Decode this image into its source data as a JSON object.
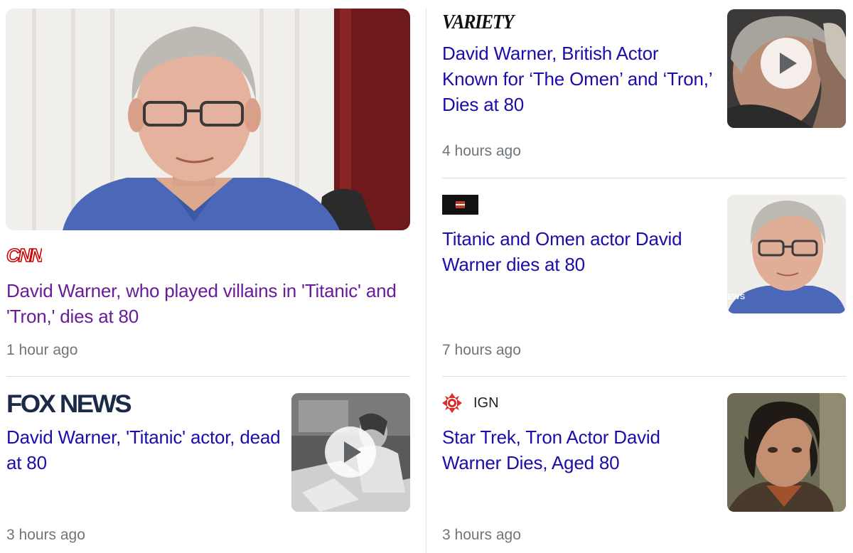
{
  "colors": {
    "link": "#1a0dab",
    "visited": "#6a1b9a",
    "meta": "#70757a",
    "cnn_red": "#cc0000",
    "fox_navy": "#1b2a47",
    "ign_red": "#e02b2b"
  },
  "stories": [
    {
      "source": "CNN",
      "source_logo": "cnn-logo",
      "headline": "David Warner, who played villains in 'Titanic' and 'Tron,' dies at 80",
      "time": "1 hour ago",
      "visited": true,
      "media": "photo"
    },
    {
      "source": "VARIETY",
      "source_logo": "variety-logo",
      "headline": "David Warner, British Actor Known for ‘The Omen’ and ‘Tron,’ Dies at 80",
      "time": "4 hours ago",
      "media": "video"
    },
    {
      "source_logo": "news-channel-logo",
      "headline": "Titanic and Omen actor David Warner dies at 80",
      "time": "7 hours ago",
      "media": "photo",
      "thumb_watermark": "EWS"
    },
    {
      "source": "FOX NEWS",
      "source_logo": "fox-news-logo",
      "headline": "David Warner, 'Titanic' actor, dead at 80",
      "time": "3 hours ago",
      "media": "video"
    },
    {
      "source": "IGN",
      "source_logo": "ign-logo",
      "headline": "Star Trek, Tron Actor David Warner Dies, Aged 80",
      "time": "3 hours ago",
      "media": "photo"
    }
  ]
}
